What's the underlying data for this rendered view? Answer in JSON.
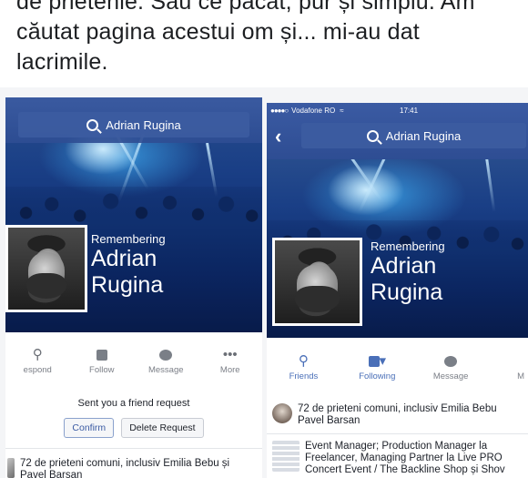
{
  "caption": {
    "lines": [
      "de prietenie. Sau ce păcat, pur și simplu. Am",
      "căutat pagina acestui om și... mi-au dat",
      "lacrimile."
    ]
  },
  "left": {
    "search_text": "Adrian Rugina",
    "remembering": "Remembering",
    "name_first": "Adrian",
    "name_last": "Rugina",
    "actions": [
      {
        "icon": "person-plus-icon",
        "label": "espond"
      },
      {
        "icon": "follow-icon",
        "label": "Follow"
      },
      {
        "icon": "message-icon",
        "label": "Message"
      },
      {
        "icon": "more-icon",
        "glyph": "•••",
        "label": "More"
      }
    ],
    "request_text": "Sent you a friend request",
    "confirm_label": "Confirm",
    "delete_label": "Delete Request",
    "mutual_line1": "72 de prieteni comuni, inclusiv Emilia Bebu și",
    "mutual_line2": "Pavel Barsan"
  },
  "right": {
    "carrier": "Vodafone RO",
    "time": "17:41",
    "back_glyph": "‹",
    "search_text": "Adrian Rugina",
    "remembering": "Remembering",
    "name_first": "Adrian",
    "name_last": "Rugina",
    "actions": [
      {
        "icon": "friends-icon",
        "label": "Friends"
      },
      {
        "icon": "following-icon",
        "label": "Following"
      },
      {
        "icon": "message-icon",
        "label": "Message"
      },
      {
        "icon": "more-icon",
        "label": "M"
      }
    ],
    "mutual_line1": "72 de prieteni comuni, inclusiv Emilia Bebu",
    "mutual_line2": "Pavel Barsan",
    "work_line1": "Event Manager; Production Manager la",
    "work_line2": "Freelancer, Managing Partner la Live PRO",
    "work_line3": "Concert Event / The Backline Shop și Shov"
  },
  "colors": {
    "facebook_blue": "#3b5ba3",
    "link_blue": "#4a6fb8"
  }
}
